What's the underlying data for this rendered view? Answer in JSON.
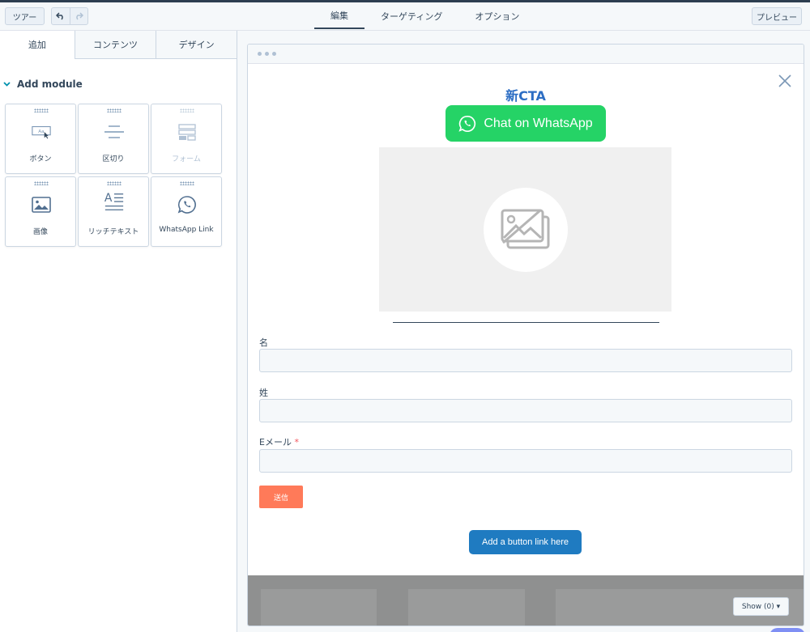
{
  "topbar": {
    "tour_label": "ツアー",
    "undo_icon": "undo-icon",
    "redo_icon": "redo-icon",
    "tabs": [
      {
        "label": "編集",
        "active": true
      },
      {
        "label": "ターゲティング",
        "active": false
      },
      {
        "label": "オプション",
        "active": false
      }
    ],
    "preview_label": "プレビュー"
  },
  "sidebar": {
    "tabs": [
      {
        "label": "追加",
        "active": true
      },
      {
        "label": "コンテンツ",
        "active": false
      },
      {
        "label": "デザイン",
        "active": false
      }
    ],
    "section_title": "Add module",
    "modules": [
      {
        "label": "ボタン",
        "icon": "button-icon",
        "disabled": false
      },
      {
        "label": "区切り",
        "icon": "divider-icon",
        "disabled": false
      },
      {
        "label": "フォーム",
        "icon": "form-icon",
        "disabled": true
      },
      {
        "label": "画像",
        "icon": "image-icon",
        "disabled": false
      },
      {
        "label": "リッチテキスト",
        "icon": "rich-text-icon",
        "disabled": false
      },
      {
        "label": "WhatsApp Link",
        "icon": "whatsapp-icon",
        "disabled": false
      }
    ]
  },
  "preview": {
    "title": "新CTA",
    "whatsapp_button": "Chat on WhatsApp",
    "form": {
      "fields": [
        {
          "label": "名",
          "required": false,
          "value": ""
        },
        {
          "label": "姓",
          "required": false,
          "value": ""
        },
        {
          "label": "Eメール",
          "required": true,
          "value": ""
        }
      ],
      "required_marker": "*",
      "submit_label": "送信"
    },
    "link_button": "Add a button link here",
    "show_button": "Show (0) ▾"
  },
  "colors": {
    "whatsapp_green": "#25d366",
    "submit_orange": "#ff7a59",
    "link_blue": "#1f7bc1",
    "title_blue": "#2d6ec4"
  }
}
